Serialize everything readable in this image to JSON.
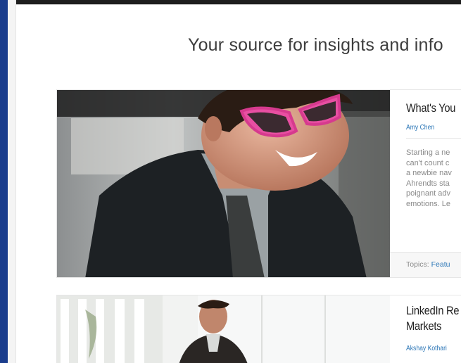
{
  "page": {
    "tagline": "Your source for insights and info"
  },
  "articles": [
    {
      "title": "What's You",
      "author": "Amy Chen",
      "excerpt_lines": [
        "Starting a ne",
        "can't count c",
        "a newbie nav",
        "Ahrendts sta",
        "poignant adv",
        "emotions. Le"
      ],
      "topics_label": "Topics:",
      "topics_value": "Featu"
    },
    {
      "title": "LinkedIn Re Markets",
      "author": "Akshay Kothari"
    }
  ],
  "colors": {
    "accent_link": "#2a75b6",
    "left_bar": "#1a3c8c",
    "top_banner": "#1e1e1e"
  }
}
